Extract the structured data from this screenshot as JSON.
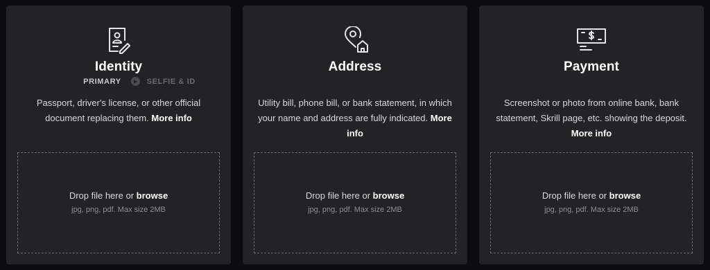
{
  "cards": [
    {
      "icon": "id-card-icon",
      "title": "Identity",
      "steps": {
        "primary": "PRIMARY",
        "secondary": "SELFIE & ID"
      },
      "desc": "Passport, driver's license, or other official document replacing them.",
      "more": "More info",
      "drop": {
        "text": "Drop file here or",
        "browse": "browse",
        "hint": "jpg, png, pdf. Max size 2MB"
      }
    },
    {
      "icon": "location-home-icon",
      "title": "Address",
      "desc": "Utility bill, phone bill, or bank statement, in which your name and address are fully indicated.",
      "more": "More info",
      "drop": {
        "text": "Drop file here or",
        "browse": "browse",
        "hint": "jpg, png, pdf. Max size 2MB"
      }
    },
    {
      "icon": "payment-card-icon",
      "title": "Payment",
      "desc": "Screenshot or photo from online bank, bank statement, Skrill page, etc. showing the deposit.",
      "more": "More info",
      "drop": {
        "text": "Drop file here or",
        "browse": "browse",
        "hint": "jpg, png, pdf. Max size 2MB"
      }
    }
  ],
  "colors": {
    "background": "#0d0d0f",
    "card": "#232326",
    "text": "#d9d9dc",
    "heading": "#ffffff"
  }
}
